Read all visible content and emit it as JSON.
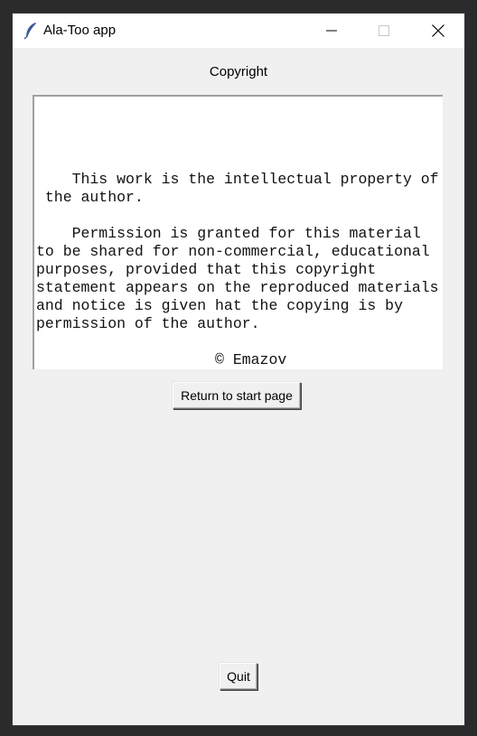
{
  "window": {
    "title": "Ala-Too app",
    "icon": "feather-icon",
    "controls": [
      "minimize-icon",
      "maximize-icon",
      "close-icon"
    ]
  },
  "main": {
    "heading": "Copyright",
    "text_lines": [
      "",
      "",
      "    This work is the intellectual property of",
      " the author.",
      "",
      "    Permission is granted for this material",
      "to be shared for non-commercial, educational",
      "purposes, provided that this copyright",
      "statement appears on the reproduced materials",
      "and notice is given hat the copying is by",
      "permission of the author.",
      "",
      "                    © Emazov"
    ],
    "return_button_label": "Return to start page",
    "quit_button_label": "Quit"
  }
}
